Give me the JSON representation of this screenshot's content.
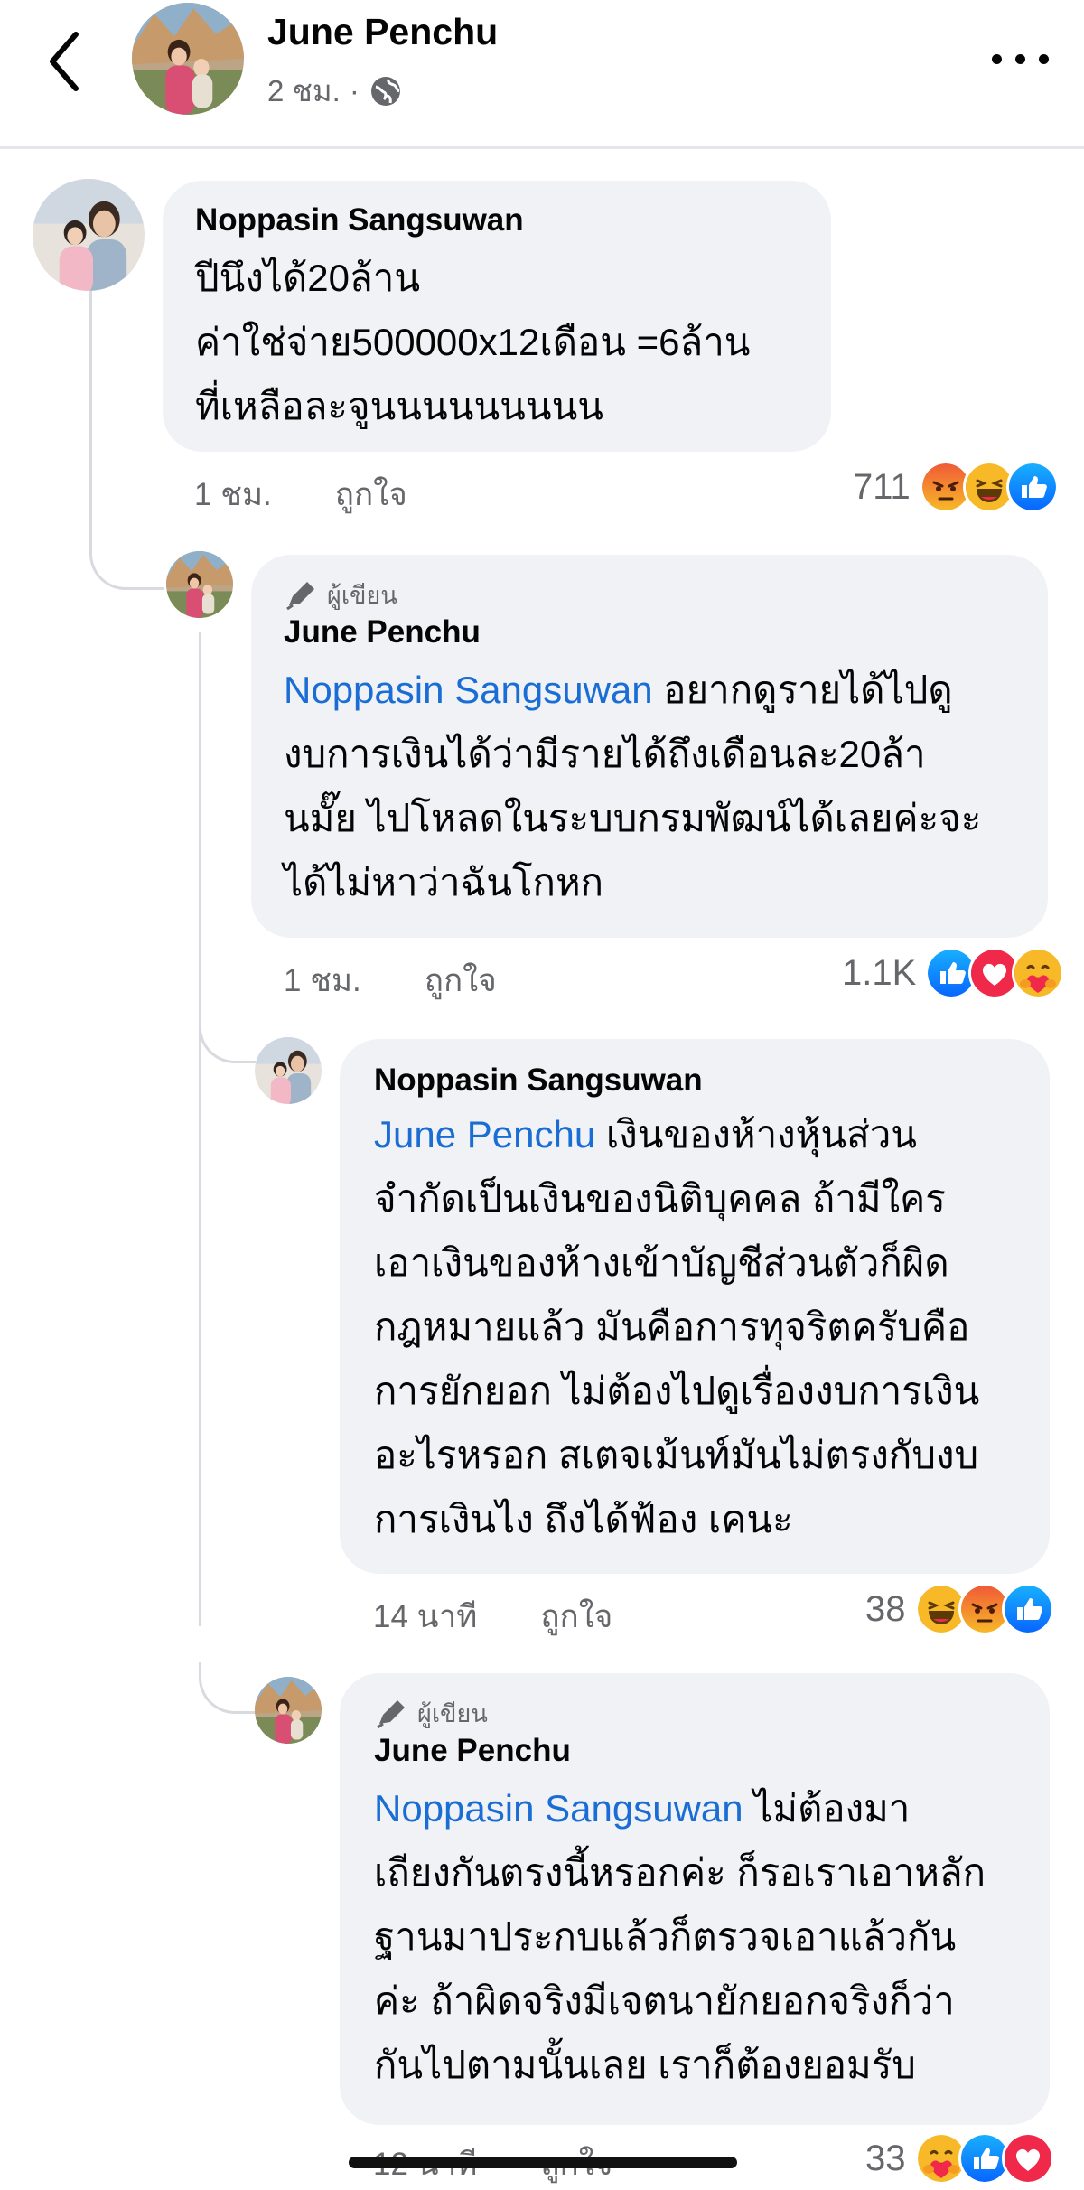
{
  "header": {
    "back_icon": "chevron-left-icon",
    "name": "June Penchu",
    "time": "2 ชม.",
    "separator": "·",
    "privacy_icon": "globe-icon",
    "more_icon": "more-horizontal-icon"
  },
  "comments": [
    {
      "name": "Noppasin Sangsuwan",
      "lines": [
        "ปีนึงได้20ล้าน",
        "ค่าใช่จ่าย500000x12เดือน =6ล้าน",
        "ที่เหลือละจูนนนนนนนนน"
      ],
      "time": "1 ชม.",
      "like": "ถูกใจ",
      "count": "711",
      "reactions": [
        "angry",
        "haha",
        "like"
      ]
    },
    {
      "author_badge": "ผู้เขียน",
      "name": "June Penchu",
      "mention": "Noppasin Sangsuwan",
      "lines_first_rest": " อยากดูรายได้ไปดู",
      "lines": [
        "งบการเงินได้ว่ามีรายได้ถึงเดือนละ20ล้า",
        "นมั๊ย ไปโหลดในระบบกรมพัฒน์ได้เลยค่ะจะ",
        "ได้ไม่หาว่าฉันโกหก"
      ],
      "time": "1 ชม.",
      "like": "ถูกใจ",
      "count": "1.1K",
      "reactions": [
        "like",
        "love",
        "care"
      ]
    },
    {
      "name": "Noppasin Sangsuwan",
      "mention": "June Penchu",
      "lines_first_rest": " เงินของห้างหุ้นส่วน",
      "lines": [
        "จำกัดเป็นเงินของนิติบุคคล ถ้ามีใคร",
        "เอาเงินของห้างเข้าบัญชีส่วนตัวก็ผิด",
        "กฎหมายแล้ว มันคือการทุจริตครับคือ",
        "การยักยอก ไม่ต้องไปดูเรื่องงบการเงิน",
        "อะไรหรอก สเตจเม้นท์มันไม่ตรงกับงบ",
        "การเงินไง ถึงได้ฟ้อง เคนะ"
      ],
      "time": "14 นาที",
      "like": "ถูกใจ",
      "count": "38",
      "reactions": [
        "haha",
        "angry",
        "like"
      ]
    },
    {
      "author_badge": "ผู้เขียน",
      "name": "June Penchu",
      "mention": "Noppasin Sangsuwan",
      "lines_first_rest": " ไม่ต้องมา",
      "lines": [
        "เถียงกันตรงนี้หรอกค่ะ ก็รอเราเอาหลัก",
        "ฐานมาประกบแล้วก็ตรวจเอาแล้วกัน",
        "ค่ะ ถ้าผิดจริงมีเจตนายักยอกจริงก็ว่า",
        "กันไปตามนั้นเลย เราก็ต้องยอมรับ"
      ],
      "time": "12 นาที",
      "like": "ถูกใจ",
      "count": "33",
      "reactions": [
        "care",
        "like",
        "love"
      ]
    }
  ],
  "colors": {
    "bubble": "#f0f2f5",
    "mention": "#1a6dd4",
    "muted": "#65676b",
    "like": "#1877f2",
    "love": "#f0284a",
    "emoji": "#f7b928"
  }
}
